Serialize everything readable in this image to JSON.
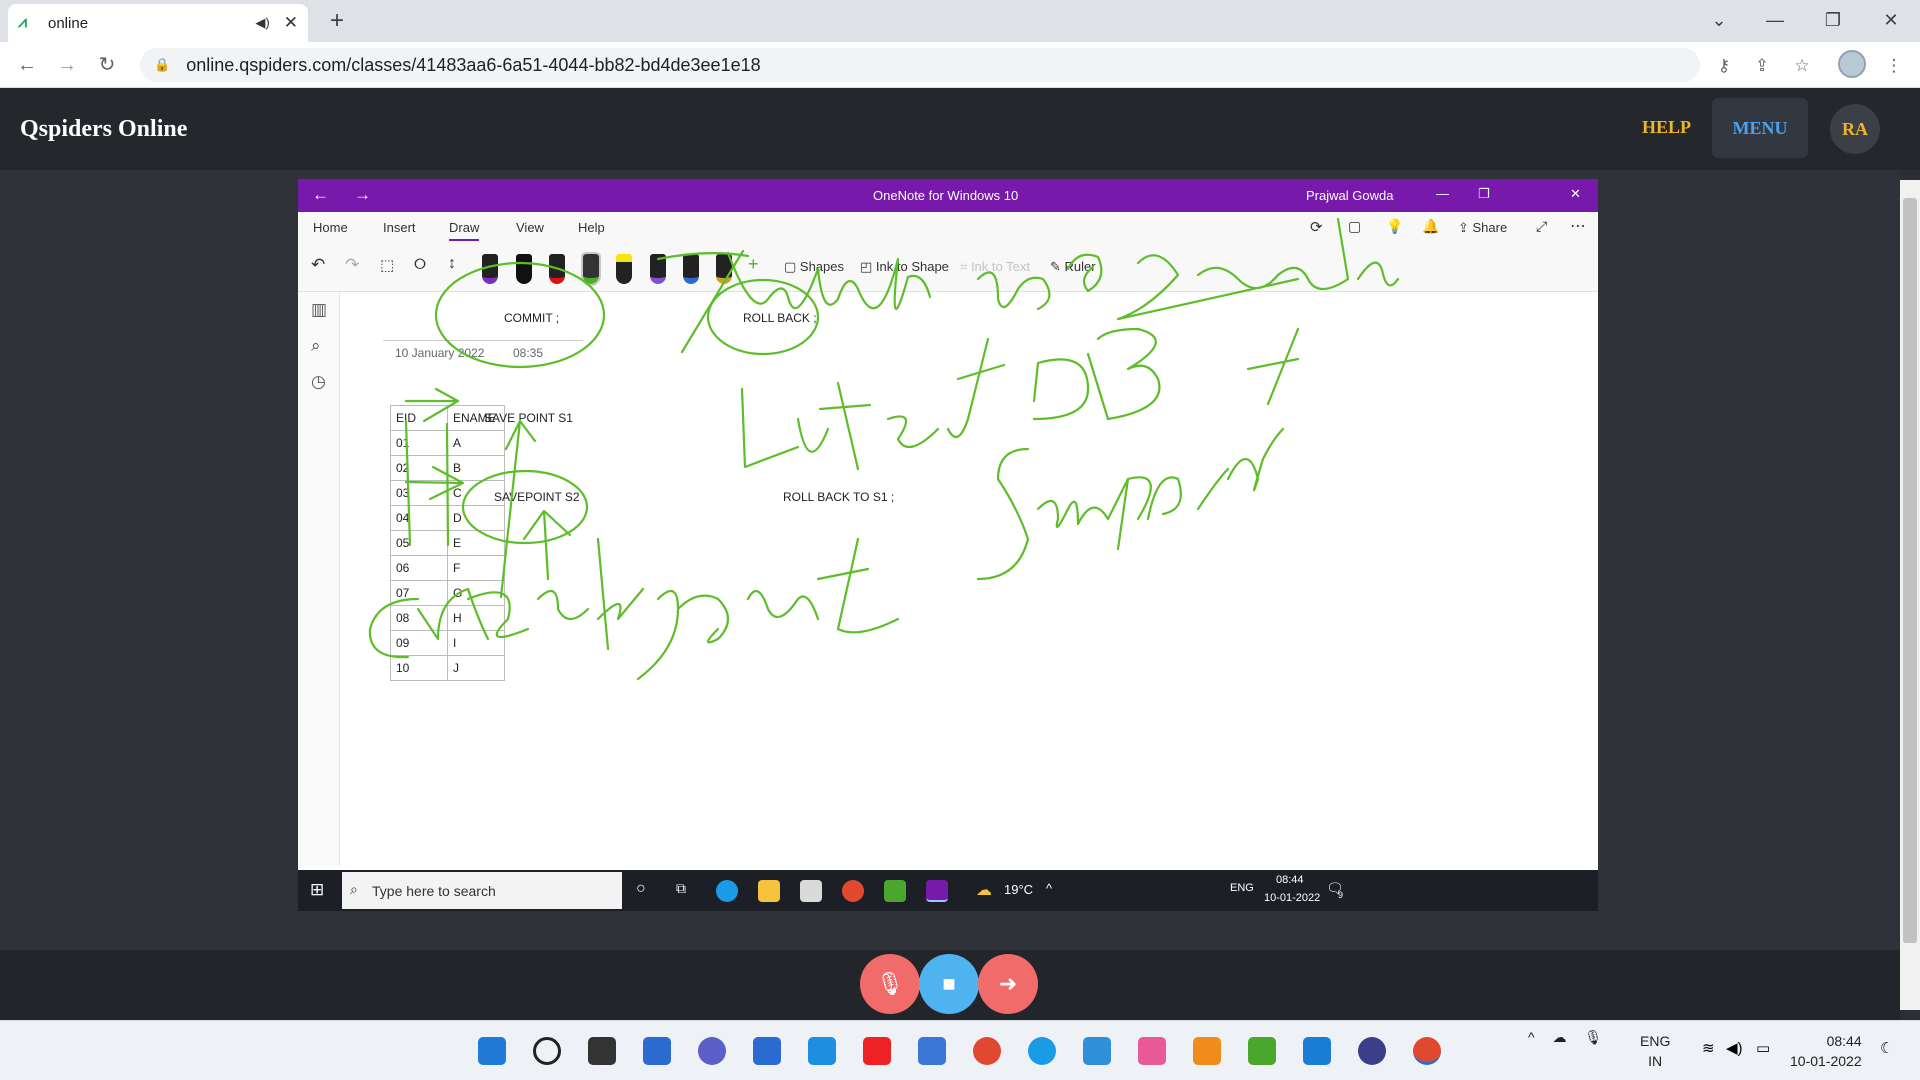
{
  "browser": {
    "tab_title": "online",
    "tab_icon": "qspiders-logo-icon",
    "url": "online.qspiders.com/classes/41483aa6-6a51-4044-bb82-bd4de3ee1e18",
    "new_tab_label": "+"
  },
  "site": {
    "brand": "Qspiders Online",
    "help_label": "HELP",
    "menu_label": "MENU",
    "avatar_initials": "RA",
    "accent_gold": "#f0b429",
    "accent_blue": "#4aa3f0"
  },
  "onenote": {
    "title": "OneNote for Windows 10",
    "user": "Prajwal Gowda",
    "ribbon_tabs": [
      "Home",
      "Insert",
      "Draw",
      "View",
      "Help"
    ],
    "share_label": "Share",
    "tools": {
      "shapes": "Shapes",
      "ink_to_shape": "Ink to Shape",
      "ink_to_text": "Ink to Text",
      "ruler": "Ruler"
    },
    "page_date": "10 January 2022",
    "page_time": "08:35",
    "table_headers": [
      "EID",
      "ENAME"
    ],
    "table_rows": [
      [
        "01",
        "A"
      ],
      [
        "02",
        "B"
      ],
      [
        "03",
        "C"
      ],
      [
        "04",
        "D"
      ],
      [
        "05",
        "E"
      ],
      [
        "06",
        "F"
      ],
      [
        "07",
        "G"
      ],
      [
        "08",
        "H"
      ],
      [
        "09",
        "I"
      ],
      [
        "10",
        "J"
      ]
    ],
    "labels": {
      "commit": "COMMIT ;",
      "rollback": "ROLL BACK ;",
      "savepoint1": "SAVE POINT  S1",
      "savepoint2": "SAVEPOINT S2",
      "rollback_s1": "ROLL BACK TO S1 ;"
    },
    "ink_color": "#5dbd2a",
    "purple": "#7719aa"
  },
  "remote_taskbar": {
    "search_placeholder": "Type here to search",
    "weather": "19°C",
    "lang": "ENG",
    "time": "08:44",
    "date": "10-01-2022",
    "notification_count": "9"
  },
  "meeting": {
    "mute_icon": "mic-off-icon",
    "chat_icon": "chat-icon",
    "leave_icon": "leave-icon"
  },
  "taskbar": {
    "lang_line1": "ENG",
    "lang_line2": "IN",
    "time": "08:44",
    "date": "10-01-2022"
  }
}
